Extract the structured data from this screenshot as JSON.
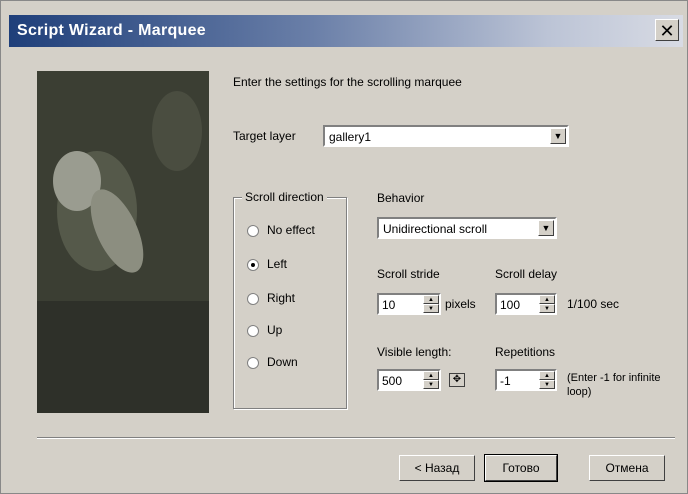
{
  "window": {
    "title": "Script Wizard - Marquee",
    "close_glyph": "✕"
  },
  "intro_text": "Enter the settings for the scrolling marquee",
  "target_layer": {
    "label": "Target layer",
    "value": "gallery1"
  },
  "scroll_direction": {
    "legend": "Scroll direction",
    "options": [
      "No effect",
      "Left",
      "Right",
      "Up",
      "Down"
    ],
    "selected": "Left"
  },
  "behavior": {
    "label": "Behavior",
    "value": "Unidirectional scroll"
  },
  "scroll_stride": {
    "label": "Scroll stride",
    "value": "10",
    "unit": "pixels"
  },
  "scroll_delay": {
    "label": "Scroll delay",
    "value": "100",
    "unit": "1/100 sec"
  },
  "visible_length": {
    "label": "Visible length:",
    "value": "500"
  },
  "repetitions": {
    "label": "Repetitions",
    "value": "-1",
    "hint": "(Enter -1 for infinite loop)"
  },
  "buttons": {
    "back": "< Назад",
    "finish": "Готово",
    "cancel": "Отмена"
  }
}
